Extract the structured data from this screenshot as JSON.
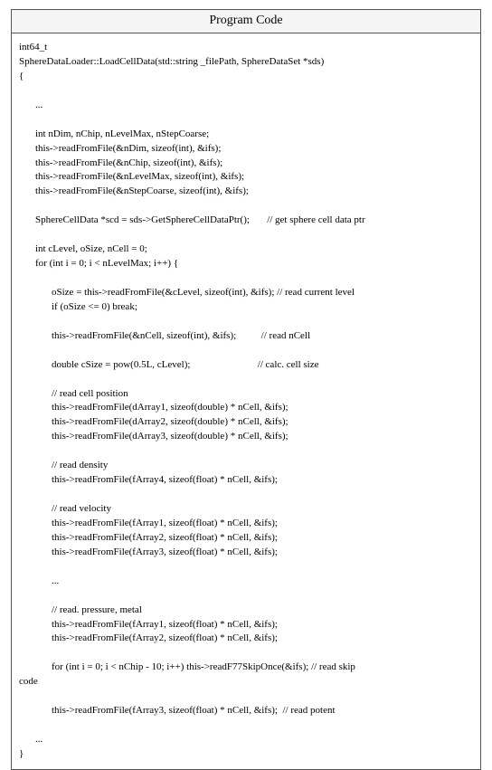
{
  "header": {
    "title": "Program Code"
  },
  "code": {
    "l01": "int64_t",
    "l02": "SphereDataLoader::LoadCellData(std::string _filePath, SphereDataSet *sds)",
    "l03": "{",
    "l04": "...",
    "l05": "int nDim, nChip, nLevelMax, nStepCoarse;",
    "l06": "this->readFromFile(&nDim, sizeof(int), &ifs);",
    "l07": "this->readFromFile(&nChip, sizeof(int), &ifs);",
    "l08": "this->readFromFile(&nLevelMax, sizeof(int), &ifs);",
    "l09": "this->readFromFile(&nStepCoarse, sizeof(int), &ifs);",
    "l10a": "SphereCellData *scd = sds->GetSphereCellDataPtr();",
    "l10b": "// get sphere cell data ptr",
    "l11": "int cLevel, oSize, nCell = 0;",
    "l12": "for (int i = 0; i < nLevelMax; i++) {",
    "l13": "oSize = this->readFromFile(&cLevel, sizeof(int), &ifs); // read current level",
    "l14": "if (oSize <= 0) break;",
    "l15a": "this->readFromFile(&nCell, sizeof(int), &ifs);",
    "l15b": "// read nCell",
    "l16a": "double cSize = pow(0.5L, cLevel);",
    "l16b": "// calc. cell size",
    "l17": "// read cell position",
    "l18": "this->readFromFile(dArray1, sizeof(double) * nCell, &ifs);",
    "l19": "this->readFromFile(dArray2, sizeof(double) * nCell, &ifs);",
    "l20": "this->readFromFile(dArray3, sizeof(double) * nCell, &ifs);",
    "l21": "// read density",
    "l22": "this->readFromFile(fArray4, sizeof(float) * nCell, &ifs);",
    "l23": "// read velocity",
    "l24": "this->readFromFile(fArray1, sizeof(float) * nCell, &ifs);",
    "l25": "this->readFromFile(fArray2, sizeof(float) * nCell, &ifs);",
    "l26": "this->readFromFile(fArray3, sizeof(float) * nCell, &ifs);",
    "l27": "...",
    "l28": "// read. pressure, metal",
    "l29": "this->readFromFile(fArray1, sizeof(float) * nCell, &ifs);",
    "l30": "this->readFromFile(fArray2, sizeof(float) * nCell, &ifs);",
    "l31a": "for (int i = 0; i < nChip - 10; i++) this->readF77SkipOnce(&ifs); // read skip",
    "l31b": "code",
    "l32": "this->readFromFile(fArray3, sizeof(float) * nCell, &ifs);  // read potent",
    "l33": "...",
    "l34": "}"
  }
}
